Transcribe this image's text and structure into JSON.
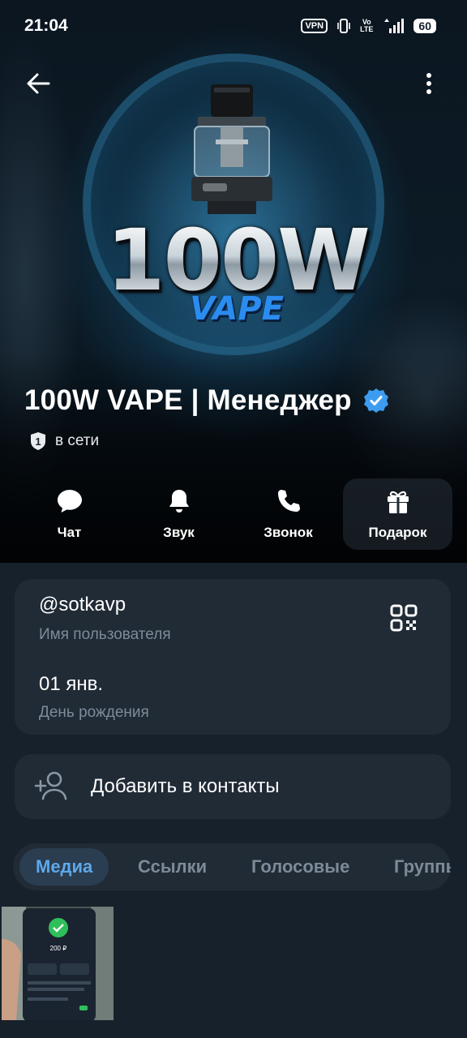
{
  "status_bar": {
    "time": "21:04",
    "vpn": "VPN",
    "volte_top": "Vo",
    "volte_bottom": "LTE",
    "battery": "60"
  },
  "cover": {
    "logo_main": "100W",
    "logo_sub": "VAPE"
  },
  "profile": {
    "name": "100W VAPE | Менеджер",
    "badge_number": "1",
    "status": "в сети"
  },
  "actions": [
    {
      "label": "Чат",
      "icon": "chat-bubble-icon"
    },
    {
      "label": "Звук",
      "icon": "bell-icon"
    },
    {
      "label": "Звонок",
      "icon": "phone-icon"
    },
    {
      "label": "Подарок",
      "icon": "gift-icon"
    }
  ],
  "info": {
    "username": "@sotkavp",
    "username_label": "Имя пользователя",
    "birthday": "01 янв.",
    "birthday_label": "День рождения"
  },
  "contact": {
    "add_label": "Добавить в контакты"
  },
  "tabs": [
    {
      "label": "Медиа",
      "active": true
    },
    {
      "label": "Ссылки",
      "active": false
    },
    {
      "label": "Голосовые",
      "active": false
    },
    {
      "label": "Группы",
      "active": false
    }
  ],
  "media_thumb": {
    "amount": "200 ₽"
  },
  "colors": {
    "background": "#17212c",
    "card": "#202b36",
    "accent": "#5ea8ea",
    "verified": "#3d9cf0"
  }
}
